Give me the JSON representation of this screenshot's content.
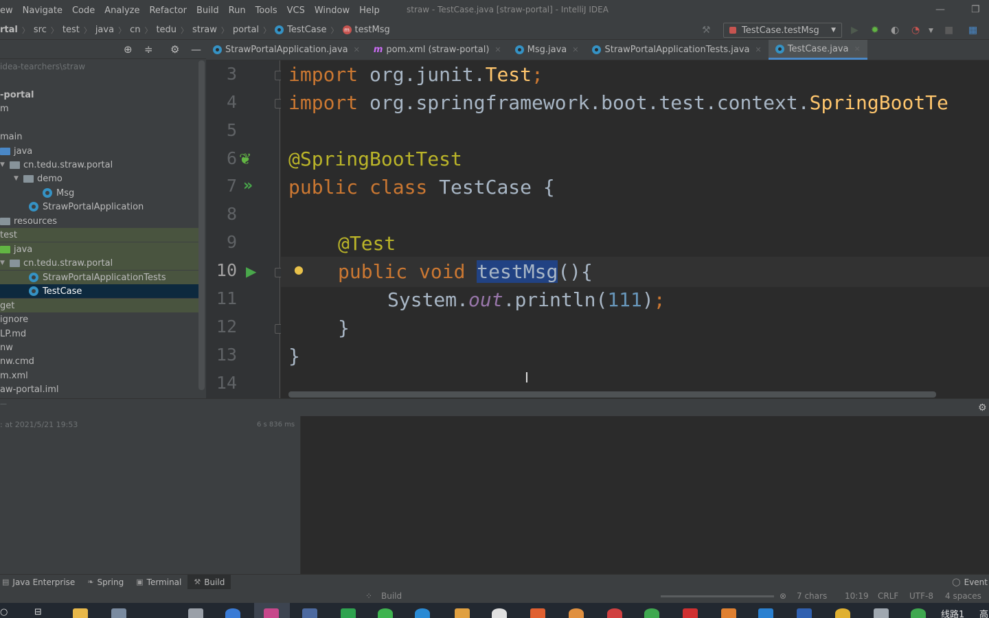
{
  "menu": [
    "ew",
    "Navigate",
    "Code",
    "Analyze",
    "Refactor",
    "Build",
    "Run",
    "Tools",
    "VCS",
    "Window",
    "Help"
  ],
  "window_title": "straw - TestCase.java [straw-portal] - IntelliJ IDEA",
  "breadcrumbs": [
    "rtal",
    "src",
    "test",
    "java",
    "cn",
    "tedu",
    "straw",
    "portal",
    "TestCase",
    "testMsg"
  ],
  "run_config": "TestCase.testMsg",
  "tabs": [
    {
      "label": "StrawPortalApplication.java"
    },
    {
      "label": "pom.xml (straw-portal)"
    },
    {
      "label": "Msg.java"
    },
    {
      "label": "StrawPortalApplicationTests.java"
    },
    {
      "label": "TestCase.java"
    }
  ],
  "project_tree": [
    "idea-tearchers\\straw",
    "-portal",
    "m",
    "main",
    "java",
    "cn.tedu.straw.portal",
    "demo",
    "Msg",
    "StrawPortalApplication",
    "resources",
    "test",
    "java",
    "cn.tedu.straw.portal",
    "StrawPortalApplicationTests",
    "TestCase",
    "get",
    "ignore",
    "LP.md",
    "nw",
    "nw.cmd",
    "m.xml",
    "aw-portal.iml"
  ],
  "line_numbers": [
    "3",
    "4",
    "5",
    "6",
    "7",
    "8",
    "9",
    "10",
    "11",
    "12",
    "13",
    "14"
  ],
  "code": {
    "l3_kw": "import",
    "l3_pkg": " org.junit.",
    "l3_cls": "Test",
    "l3_end": ";",
    "l4_kw": "import",
    "l4_pkg": " org.springframework.boot.test.context.",
    "l4_cls": "SpringBootTe",
    "l6_anno": "@SpringBootTest",
    "l7_kw": "public class",
    "l7_name": " TestCase {",
    "l9_anno": "@Test",
    "l10_kw": "public void",
    "l10_sp": " ",
    "l10_method": "testMsg",
    "l10_end": "(){",
    "l11_obj": "System.",
    "l11_field": "out",
    "l11_call": ".println(",
    "l11_num": "111",
    "l11_close": ")",
    "l11_semi": ";",
    "l12": "}",
    "l13": "}"
  },
  "build": {
    "status": ": at 2021/5/21 19:53",
    "time": "6 s 836 ms"
  },
  "tool_windows": [
    "Java Enterprise",
    "Spring",
    "Terminal",
    "Build"
  ],
  "event_log": "Event",
  "status": {
    "build": "Build",
    "chars": "7 chars",
    "pos": "10:19",
    "eol": "CRLF",
    "enc": "UTF-8",
    "indent": "4 spaces"
  },
  "taskbar_text": "线路1",
  "taskbar_text2": "高"
}
